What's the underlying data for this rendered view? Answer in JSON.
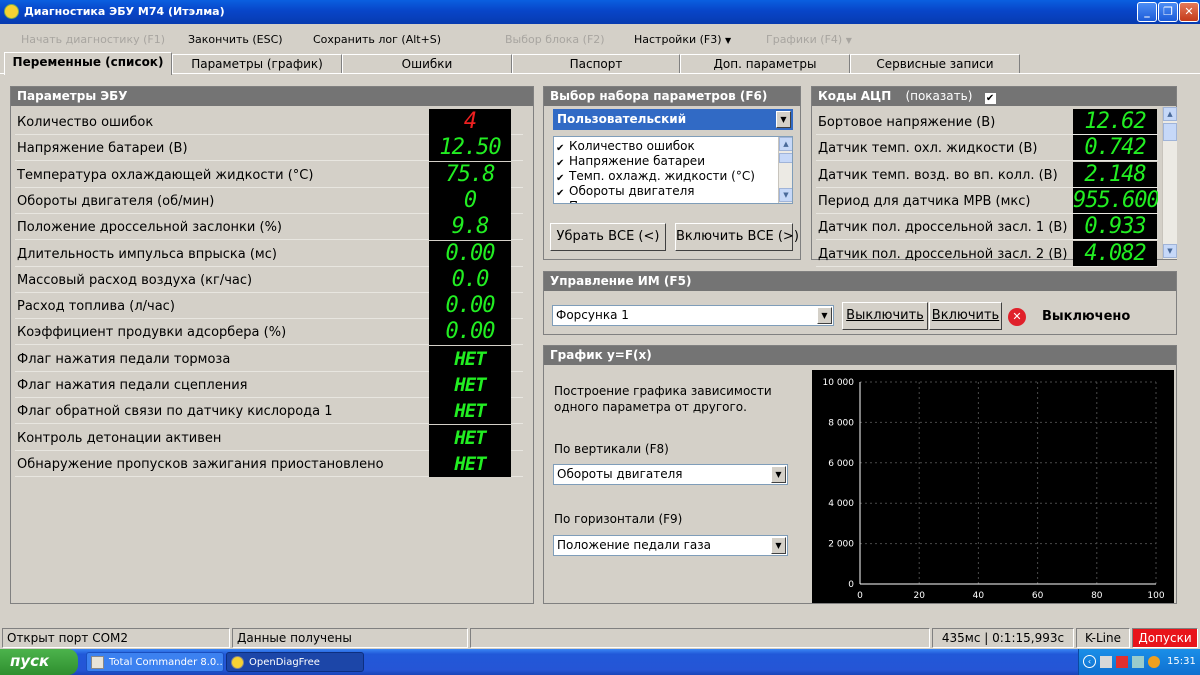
{
  "window": {
    "title": "Диагностика ЭБУ М74 (Итэлма)"
  },
  "menu": {
    "start_diag": "Начать диагностику (F1)",
    "finish": "Закончить (ESC)",
    "save_log": "Сохранить лог (Alt+S)",
    "select_block": "Выбор блока (F2)",
    "settings": "Настройки (F3)",
    "graphs": "Графики (F4)"
  },
  "tabs": [
    "Переменные (список)",
    "Параметры (график)",
    "Ошибки",
    "Паспорт",
    "Доп. параметры",
    "Сервисные записи"
  ],
  "ecu": {
    "title": "Параметры ЭБУ",
    "rows": [
      {
        "label": "Количество ошибок",
        "value": "4"
      },
      {
        "label": "Напряжение батареи (В)",
        "value": "12.50"
      },
      {
        "label": "Температура охлаждающей жидкости (°С)",
        "value": "75.8"
      },
      {
        "label": "Обороты двигателя (об/мин)",
        "value": "0"
      },
      {
        "label": "Положение дроссельной заслонки (%)",
        "value": "9.8"
      },
      {
        "label": "Длительность импульса впрыска (мс)",
        "value": "0.00"
      },
      {
        "label": "Массовый расход воздуха (кг/час)",
        "value": "0.0"
      },
      {
        "label": "Расход топлива (л/час)",
        "value": "0.00"
      },
      {
        "label": "Коэффициент продувки адсорбера (%)",
        "value": "0.00"
      },
      {
        "label": "Флаг нажатия педали тормоза",
        "value": "НЕТ"
      },
      {
        "label": "Флаг нажатия педали сцепления",
        "value": "НЕТ"
      },
      {
        "label": "Флаг обратной связи по датчику кислорода 1",
        "value": "НЕТ"
      },
      {
        "label": "Контроль детонации активен",
        "value": "НЕТ"
      },
      {
        "label": "Обнаружение пропусков зажигания приостановлено",
        "value": "НЕТ"
      }
    ]
  },
  "paramset": {
    "title": "Выбор набора параметров (F6)",
    "selected": "Пользовательский",
    "items": [
      "Количество ошибок",
      "Напряжение батареи",
      "Темп. охлажд. жидкости (°С)",
      "Обороты двигателя",
      "Положение дросселя"
    ],
    "remove_all": "Убрать ВСЕ (<)",
    "add_all": "Включить ВСЕ (>)"
  },
  "adc": {
    "title": "Коды АЦП",
    "show_label": "(показать)",
    "rows": [
      {
        "label": "Бортовое напряжение (В)",
        "value": "12.62"
      },
      {
        "label": "Датчик темп. охл. жидкости (В)",
        "value": "0.742"
      },
      {
        "label": "Датчик темп. возд. во вп. колл. (В)",
        "value": "2.148"
      },
      {
        "label": "Период для датчика МРВ (мкс)",
        "value": "955.600"
      },
      {
        "label": "Датчик пол. дроссельной засл. 1 (В)",
        "value": "0.933"
      },
      {
        "label": "Датчик пол. дроссельной засл. 2 (В)",
        "value": "4.082"
      }
    ]
  },
  "control": {
    "title": "Управление ИМ (F5)",
    "selected": "Форсунка 1",
    "off_btn": "Выключить",
    "on_btn": "Включить",
    "status": "Выключено"
  },
  "graph": {
    "title": "График y=F(x)",
    "desc1": "Построение графика зависимости",
    "desc2": "одного параметра от другого.",
    "vert_label": "По вертикали (F8)",
    "vert_value": "Обороты двигателя",
    "horiz_label": "По горизонтали (F9)",
    "horiz_value": "Положение педали газа"
  },
  "chart_data": {
    "type": "scatter",
    "x": [],
    "y": [],
    "xlim": [
      0,
      100
    ],
    "ylim": [
      0,
      10000
    ],
    "xticks": [
      "0",
      "20",
      "40",
      "60",
      "80",
      "100"
    ],
    "yticks": [
      "0",
      "2 000",
      "4 000",
      "6 000",
      "8 000",
      "10 000"
    ],
    "grid": true,
    "background": "#000000",
    "grid_color": "#4a4a4a"
  },
  "status": {
    "port": "Открыт порт COM2",
    "data": "Данные получены",
    "time": "435мс | 0:1:15,993с",
    "protocol": "K-Line",
    "warning": "Допуски"
  },
  "taskbar": {
    "start": "пуск",
    "tasks": [
      "Total Commander 8.0...",
      "OpenDiagFree"
    ],
    "clock": "15:31"
  }
}
